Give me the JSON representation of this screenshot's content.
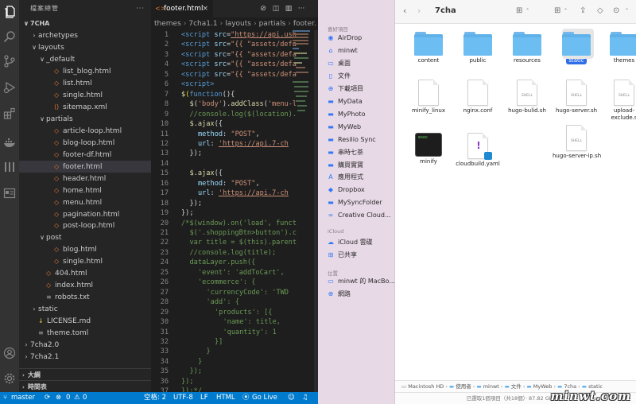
{
  "vscode": {
    "explorer_title": "檔案總管",
    "more": "···",
    "tree": [
      {
        "label": "7CHA",
        "kind": "root",
        "indent": 0,
        "chev": "∨"
      },
      {
        "label": "archetypes",
        "kind": "folder",
        "indent": 1,
        "chev": "›"
      },
      {
        "label": "layouts",
        "kind": "folder",
        "indent": 1,
        "chev": "∨"
      },
      {
        "label": "_default",
        "kind": "folder",
        "indent": 2,
        "chev": "∨"
      },
      {
        "label": "list_blog.html",
        "kind": "file",
        "indent": 3
      },
      {
        "label": "list.html",
        "kind": "file",
        "indent": 3
      },
      {
        "label": "single.html",
        "kind": "file",
        "indent": 3
      },
      {
        "label": "sitemap.xml",
        "kind": "xml",
        "indent": 3
      },
      {
        "label": "partials",
        "kind": "folder",
        "indent": 2,
        "chev": "∨"
      },
      {
        "label": "article-loop.html",
        "kind": "file",
        "indent": 3
      },
      {
        "label": "blog-loop.html",
        "kind": "file",
        "indent": 3
      },
      {
        "label": "footer-df.html",
        "kind": "file",
        "indent": 3
      },
      {
        "label": "footer.html",
        "kind": "file",
        "indent": 3,
        "selected": true
      },
      {
        "label": "header.html",
        "kind": "file",
        "indent": 3
      },
      {
        "label": "home.html",
        "kind": "file",
        "indent": 3
      },
      {
        "label": "menu.html",
        "kind": "file",
        "indent": 3
      },
      {
        "label": "pagination.html",
        "kind": "file",
        "indent": 3
      },
      {
        "label": "post-loop.html",
        "kind": "file",
        "indent": 3
      },
      {
        "label": "post",
        "kind": "folder",
        "indent": 2,
        "chev": "∨"
      },
      {
        "label": "blog.html",
        "kind": "file",
        "indent": 3
      },
      {
        "label": "single.html",
        "kind": "file",
        "indent": 3
      },
      {
        "label": "404.html",
        "kind": "file",
        "indent": 2
      },
      {
        "label": "index.html",
        "kind": "file",
        "indent": 2
      },
      {
        "label": "robots.txt",
        "kind": "txt",
        "indent": 2
      },
      {
        "label": "static",
        "kind": "folder",
        "indent": 1,
        "chev": "›"
      },
      {
        "label": "LICENSE.md",
        "kind": "md",
        "indent": 1
      },
      {
        "label": "theme.toml",
        "kind": "toml",
        "indent": 1
      },
      {
        "label": "7cha2.0",
        "kind": "folder",
        "indent": 0,
        "chev": "›"
      },
      {
        "label": "7cha2.1",
        "kind": "folder",
        "indent": 0,
        "chev": "›"
      }
    ],
    "sections": [
      "大綱",
      "時間表"
    ],
    "tab_label": "footer.html",
    "tab_close": "×",
    "breadcrumb": [
      "themes",
      "7cha1.1",
      "layouts",
      "partials",
      "footer."
    ],
    "code_lines": [
      {
        "n": "1",
        "ind": 0,
        "parts": [
          [
            "t-tag",
            "<script "
          ],
          [
            "t-attr",
            "src"
          ],
          [
            "t-pn",
            "="
          ],
          [
            "t-url",
            "\"https://api.ush"
          ]
        ]
      },
      {
        "n": "2",
        "ind": 0,
        "parts": [
          [
            "t-tag",
            "<script "
          ],
          [
            "t-attr",
            "src"
          ],
          [
            "t-pn",
            "="
          ],
          [
            "t-str",
            "\"{{ \"assets/defa"
          ]
        ]
      },
      {
        "n": "3",
        "ind": 0,
        "parts": [
          [
            "t-tag",
            "<script "
          ],
          [
            "t-attr",
            "src"
          ],
          [
            "t-pn",
            "="
          ],
          [
            "t-str",
            "\"{{ \"assets/defa"
          ]
        ]
      },
      {
        "n": "4",
        "ind": 0,
        "parts": [
          [
            "t-tag",
            "<script "
          ],
          [
            "t-attr",
            "src"
          ],
          [
            "t-pn",
            "="
          ],
          [
            "t-str",
            "\"{{ \"assets/defa"
          ]
        ]
      },
      {
        "n": "5",
        "ind": 0,
        "parts": [
          [
            "t-tag",
            "<script "
          ],
          [
            "t-attr",
            "src"
          ],
          [
            "t-pn",
            "="
          ],
          [
            "t-str",
            "\"{{ \"assets/defa"
          ]
        ]
      },
      {
        "n": "6",
        "ind": 0,
        "parts": [
          [
            "t-tag",
            "<script>"
          ]
        ]
      },
      {
        "n": "7",
        "ind": 0,
        "parts": [
          [
            "t-fn",
            "$"
          ],
          [
            "t-br",
            "("
          ],
          [
            "t-kw",
            "function"
          ],
          [
            "t-pn",
            "(){"
          ]
        ]
      },
      {
        "n": "8",
        "ind": 1,
        "parts": [
          [
            "t-fn",
            "$"
          ],
          [
            "t-pn",
            "("
          ],
          [
            "t-str",
            "'body'"
          ],
          [
            "t-pn",
            ")."
          ],
          [
            "t-fn",
            "addClass"
          ],
          [
            "t-pn",
            "("
          ],
          [
            "t-str",
            "'menu-l"
          ]
        ]
      },
      {
        "n": "9",
        "ind": 1,
        "parts": [
          [
            "t-cm",
            "//console.log($(location)."
          ]
        ]
      },
      {
        "n": "10",
        "ind": 1,
        "parts": [
          [
            "t-fn",
            "$"
          ],
          [
            "t-pn",
            "."
          ],
          [
            "t-fn",
            "ajax"
          ],
          [
            "t-pn",
            "({"
          ]
        ]
      },
      {
        "n": "11",
        "ind": 2,
        "parts": [
          [
            "t-attr",
            "method"
          ],
          [
            "t-pn",
            ": "
          ],
          [
            "t-str",
            "\"POST\""
          ],
          [
            "t-pn",
            ","
          ]
        ]
      },
      {
        "n": "12",
        "ind": 2,
        "parts": [
          [
            "t-attr",
            "url"
          ],
          [
            "t-pn",
            ": "
          ],
          [
            "t-url",
            "'https://api.7-ch"
          ]
        ]
      },
      {
        "n": "13",
        "ind": 1,
        "parts": [
          [
            "t-pn",
            "});"
          ]
        ]
      },
      {
        "n": "14",
        "ind": 0,
        "parts": []
      },
      {
        "n": "15",
        "ind": 1,
        "parts": [
          [
            "t-fn",
            "$"
          ],
          [
            "t-pn",
            "."
          ],
          [
            "t-fn",
            "ajax"
          ],
          [
            "t-pn",
            "({"
          ]
        ]
      },
      {
        "n": "16",
        "ind": 2,
        "parts": [
          [
            "t-attr",
            "method"
          ],
          [
            "t-pn",
            ": "
          ],
          [
            "t-str",
            "\"POST\""
          ],
          [
            "t-pn",
            ","
          ]
        ]
      },
      {
        "n": "17",
        "ind": 2,
        "parts": [
          [
            "t-attr",
            "url"
          ],
          [
            "t-pn",
            ": "
          ],
          [
            "t-url",
            "'https://api.7-ch"
          ]
        ]
      },
      {
        "n": "18",
        "ind": 1,
        "parts": [
          [
            "t-pn",
            "});"
          ]
        ]
      },
      {
        "n": "19",
        "ind": 0,
        "parts": [
          [
            "t-pn",
            "});"
          ]
        ]
      },
      {
        "n": "20",
        "ind": 0,
        "parts": [
          [
            "t-cm",
            "/*$(window).on('load', funct"
          ]
        ]
      },
      {
        "n": "21",
        "ind": 1,
        "parts": [
          [
            "t-cm",
            "$('.shoppingBtn>button').c"
          ]
        ]
      },
      {
        "n": "22",
        "ind": 1,
        "parts": [
          [
            "t-cm",
            "var title = $(this).parent"
          ]
        ]
      },
      {
        "n": "23",
        "ind": 1,
        "parts": [
          [
            "t-cm",
            "//console.log(title);"
          ]
        ]
      },
      {
        "n": "24",
        "ind": 1,
        "parts": [
          [
            "t-cm",
            "dataLayer.push({"
          ]
        ]
      },
      {
        "n": "25",
        "ind": 2,
        "parts": [
          [
            "t-cm",
            "'event': 'addToCart',"
          ]
        ]
      },
      {
        "n": "26",
        "ind": 2,
        "parts": [
          [
            "t-cm",
            "'ecommerce': {"
          ]
        ]
      },
      {
        "n": "27",
        "ind": 3,
        "parts": [
          [
            "t-cm",
            "'currencyCode': 'TWD"
          ]
        ]
      },
      {
        "n": "28",
        "ind": 3,
        "parts": [
          [
            "t-cm",
            "'add': {"
          ]
        ]
      },
      {
        "n": "29",
        "ind": 4,
        "parts": [
          [
            "t-cm",
            "'products': [{"
          ]
        ]
      },
      {
        "n": "30",
        "ind": 5,
        "parts": [
          [
            "t-cm",
            "'name': title,"
          ]
        ]
      },
      {
        "n": "31",
        "ind": 5,
        "parts": [
          [
            "t-cm",
            "'quantity': 1"
          ]
        ]
      },
      {
        "n": "32",
        "ind": 4,
        "parts": [
          [
            "t-cm",
            "}]"
          ]
        ]
      },
      {
        "n": "33",
        "ind": 3,
        "parts": [
          [
            "t-cm",
            "}"
          ]
        ]
      },
      {
        "n": "34",
        "ind": 2,
        "parts": [
          [
            "t-cm",
            "}"
          ]
        ]
      },
      {
        "n": "35",
        "ind": 1,
        "parts": [
          [
            "t-cm",
            "});"
          ]
        ]
      },
      {
        "n": "36",
        "ind": 0,
        "parts": [
          [
            "t-cm",
            "});"
          ]
        ]
      },
      {
        "n": "37",
        "ind": 0,
        "parts": [
          [
            "t-cm",
            "});*/"
          ]
        ]
      }
    ],
    "status": {
      "branch": "master",
      "errors": "0",
      "warnings": "0",
      "spaces": "空格: 2",
      "encoding": "UTF-8",
      "eol": "LF",
      "language": "HTML",
      "golive": "Go Live"
    },
    "colors": {
      "statusbar": "#007acc",
      "editor_bg": "#1e1e1e",
      "sidebar_bg": "#252526"
    }
  },
  "finder": {
    "title": "7cha",
    "sidebar": {
      "favorites_head": "喜好項目",
      "favorites": [
        {
          "label": "AirDrop",
          "icon": "airdrop-icon",
          "glyph": "◉"
        },
        {
          "label": "minwt",
          "icon": "home-icon",
          "glyph": "⌂"
        },
        {
          "label": "桌面",
          "icon": "desktop-icon",
          "glyph": "▭"
        },
        {
          "label": "文件",
          "icon": "document-icon",
          "glyph": "▯"
        },
        {
          "label": "下載項目",
          "icon": "download-icon",
          "glyph": "⊕"
        },
        {
          "label": "MyData",
          "icon": "folder-icon",
          "glyph": "▬"
        },
        {
          "label": "MyPhoto",
          "icon": "folder-icon",
          "glyph": "▬"
        },
        {
          "label": "MyWeb",
          "icon": "folder-icon",
          "glyph": "▬"
        },
        {
          "label": "Resilio Sync",
          "icon": "folder-icon",
          "glyph": "▬"
        },
        {
          "label": "串時七茶",
          "icon": "folder-icon",
          "glyph": "▬"
        },
        {
          "label": "購買實寶",
          "icon": "folder-icon",
          "glyph": "▬"
        },
        {
          "label": "應用程式",
          "icon": "applications-icon",
          "glyph": "A"
        },
        {
          "label": "Dropbox",
          "icon": "dropbox-icon",
          "glyph": "◆"
        },
        {
          "label": "MySyncFolder",
          "icon": "folder-icon",
          "glyph": "▬"
        },
        {
          "label": "Creative Cloud...",
          "icon": "creative-cloud-icon",
          "glyph": "∞"
        }
      ],
      "icloud_head": "iCloud",
      "icloud": [
        {
          "label": "iCloud 雲碟",
          "icon": "cloud-icon",
          "glyph": "☁"
        },
        {
          "label": "已共享",
          "icon": "shared-icon",
          "glyph": "⊞"
        }
      ],
      "locations_head": "位置",
      "locations": [
        {
          "label": "minwt 的 MacBo...",
          "icon": "laptop-icon",
          "glyph": "▭"
        },
        {
          "label": "網路",
          "icon": "network-icon",
          "glyph": "⊕"
        }
      ]
    },
    "items": [
      {
        "label": "content",
        "type": "folder"
      },
      {
        "label": "public",
        "type": "folder"
      },
      {
        "label": "resources",
        "type": "folder"
      },
      {
        "label": "static",
        "type": "folder",
        "selected": true
      },
      {
        "label": "themes",
        "type": "folder"
      },
      {
        "label": "minify_linux",
        "type": "doc",
        "tag": ""
      },
      {
        "label": "nginx.conf",
        "type": "doc",
        "tag": ""
      },
      {
        "label": "hugo-bulid.sh",
        "type": "doc",
        "tag": "SHELL"
      },
      {
        "label": "hugo-server.sh",
        "type": "doc",
        "tag": "SHELL"
      },
      {
        "label": "upload-\nexclude.s",
        "type": "doc",
        "tag": "SHELL"
      },
      {
        "label": "minify",
        "type": "exec",
        "tag": "exec"
      },
      {
        "label": "cloudbuild.yaml",
        "type": "yaml",
        "tag": ""
      },
      {
        "label": "",
        "type": "none"
      },
      {
        "label": "hugo-server-ip.sh",
        "type": "doc",
        "tag": "SHELL"
      }
    ],
    "pathbar": [
      "Macintosh HD",
      "使用者",
      "minwt",
      "文件",
      "MyWeb",
      "7cha",
      "static"
    ],
    "statusline": "已選取1個項目（共18個）· 87.82 GB 可用",
    "watermark": "minwt.com"
  }
}
